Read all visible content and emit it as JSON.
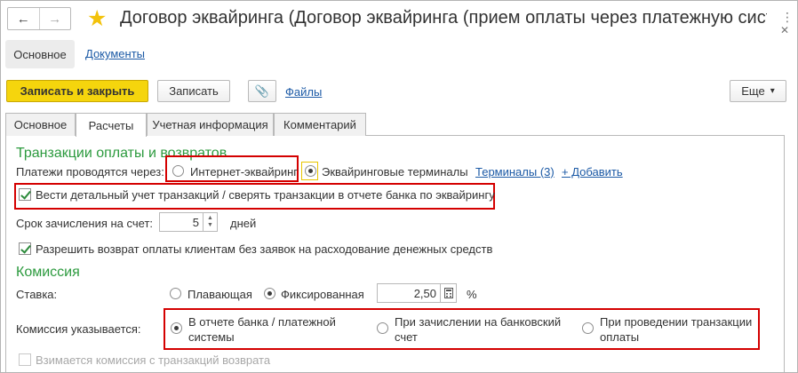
{
  "window": {
    "title": "Договор эквайринга (Договор эквайринга (прием оплаты через платежную систе...",
    "back_icon": "←",
    "forward_icon": "→",
    "star_icon": "★",
    "more_icon": "⋮",
    "close_icon": "✕"
  },
  "section_tabs": {
    "main": "Основное",
    "documents": "Документы"
  },
  "command_bar": {
    "save_close": "Записать и закрыть",
    "save": "Записать",
    "attach_icon": "📎",
    "files": "Файлы",
    "more": "Еще",
    "more_arrow": "▾"
  },
  "tabs": [
    "Основное",
    "Расчеты",
    "Учетная информация",
    "Комментарий"
  ],
  "active_tab": "Расчеты",
  "payments": {
    "group_title": "Транзакции оплаты и возвратов",
    "label": "Платежи проводятся через:",
    "option_internet": "Интернет-эквайринг",
    "option_terminals": "Эквайринговые терминалы",
    "selected": "Эквайринговые терминалы",
    "terminals_link": "Терминалы (3)",
    "add_link": "+ Добавить",
    "detailed_accounting": "Вести детальный учет транзакций / сверять транзакции в отчете банка по эквайрингу",
    "detailed_accounting_checked": true,
    "term_label": "Срок зачисления на счет:",
    "term_value": "5",
    "term_unit": "дней",
    "allow_refund": "Разрешить возврат оплаты клиентам без заявок на расходование денежных средств",
    "allow_refund_checked": true
  },
  "commission": {
    "group_title": "Комиссия",
    "rate_label": "Ставка:",
    "option_floating": "Плавающая",
    "option_fixed": "Фиксированная",
    "selected_rate": "Фиксированная",
    "rate_value": "2,50",
    "rate_unit": "%",
    "indicated_label": "Комиссия указывается:",
    "opt_bank_report_1": "В отчете банка / платежной",
    "opt_bank_report_2": "системы",
    "opt_bank_account_1": "При зачислении на банковский",
    "opt_bank_account_2": "счет",
    "opt_transaction_1": "При проведении транзакции",
    "opt_transaction_2": "оплаты",
    "selected_indicated": "В отчете банка / платежной системы",
    "refund_commission": "Взимается комиссия с транзакций возврата",
    "refund_commission_checked": false
  },
  "colors": {
    "accent": "#f5d50d",
    "group_title": "#2c9a3e",
    "link": "#1c5aa6",
    "highlight": "#d40000"
  }
}
